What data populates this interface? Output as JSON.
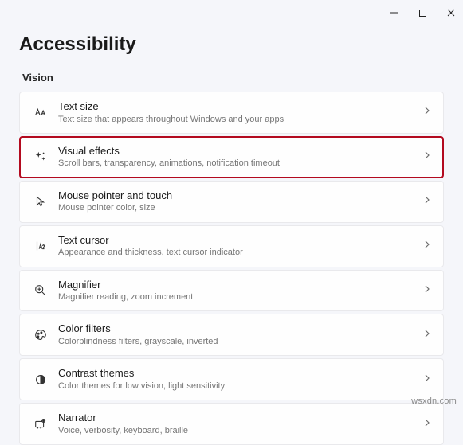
{
  "window": {
    "minimize_label": "Minimize",
    "maximize_label": "Maximize",
    "close_label": "Close"
  },
  "page": {
    "title": "Accessibility",
    "section": "Vision"
  },
  "items": [
    {
      "icon": "text-size-icon",
      "title": "Text size",
      "subtitle": "Text size that appears throughout Windows and your apps",
      "highlighted": false
    },
    {
      "icon": "visual-effects-icon",
      "title": "Visual effects",
      "subtitle": "Scroll bars, transparency, animations, notification timeout",
      "highlighted": true
    },
    {
      "icon": "mouse-pointer-icon",
      "title": "Mouse pointer and touch",
      "subtitle": "Mouse pointer color, size",
      "highlighted": false
    },
    {
      "icon": "text-cursor-icon",
      "title": "Text cursor",
      "subtitle": "Appearance and thickness, text cursor indicator",
      "highlighted": false
    },
    {
      "icon": "magnifier-icon",
      "title": "Magnifier",
      "subtitle": "Magnifier reading, zoom increment",
      "highlighted": false
    },
    {
      "icon": "color-filters-icon",
      "title": "Color filters",
      "subtitle": "Colorblindness filters, grayscale, inverted",
      "highlighted": false
    },
    {
      "icon": "contrast-themes-icon",
      "title": "Contrast themes",
      "subtitle": "Color themes for low vision, light sensitivity",
      "highlighted": false
    },
    {
      "icon": "narrator-icon",
      "title": "Narrator",
      "subtitle": "Voice, verbosity, keyboard, braille",
      "highlighted": false
    }
  ],
  "watermark": "wsxdn.com"
}
